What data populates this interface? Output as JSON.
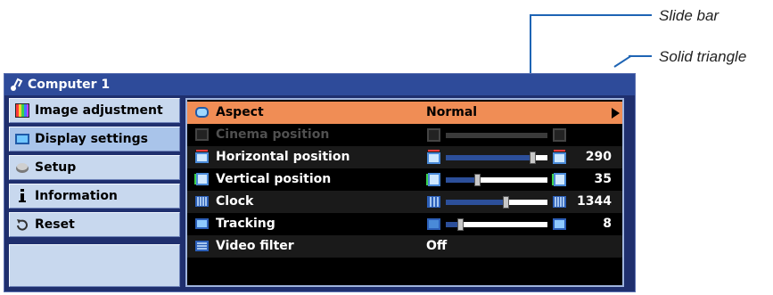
{
  "callouts": {
    "slide_bar": "Slide bar",
    "solid_triangle": "Solid triangle"
  },
  "window": {
    "title": "Computer 1"
  },
  "sidebar": {
    "items": [
      {
        "label": "Image adjustment",
        "icon": "image-adjustment-icon"
      },
      {
        "label": "Display settings",
        "icon": "display-settings-icon"
      },
      {
        "label": "Setup",
        "icon": "setup-icon"
      },
      {
        "label": "Information",
        "icon": "information-icon"
      },
      {
        "label": "Reset",
        "icon": "reset-icon"
      }
    ]
  },
  "menu": {
    "rows": [
      {
        "label": "Aspect",
        "value": "Normal"
      },
      {
        "label": "Cinema position"
      },
      {
        "label": "Horizontal position",
        "value": "290",
        "level": 0.88
      },
      {
        "label": "Vertical position",
        "value": "35",
        "level": 0.3
      },
      {
        "label": "Clock",
        "value": "1344",
        "level": 0.6
      },
      {
        "label": "Tracking",
        "value": "8",
        "level": 0.12
      },
      {
        "label": "Video filter",
        "value": "Off"
      }
    ]
  },
  "colors": {
    "highlight": "#f08d55",
    "window_bg": "#1f2f6e",
    "callout_line": "#1e64b4"
  }
}
